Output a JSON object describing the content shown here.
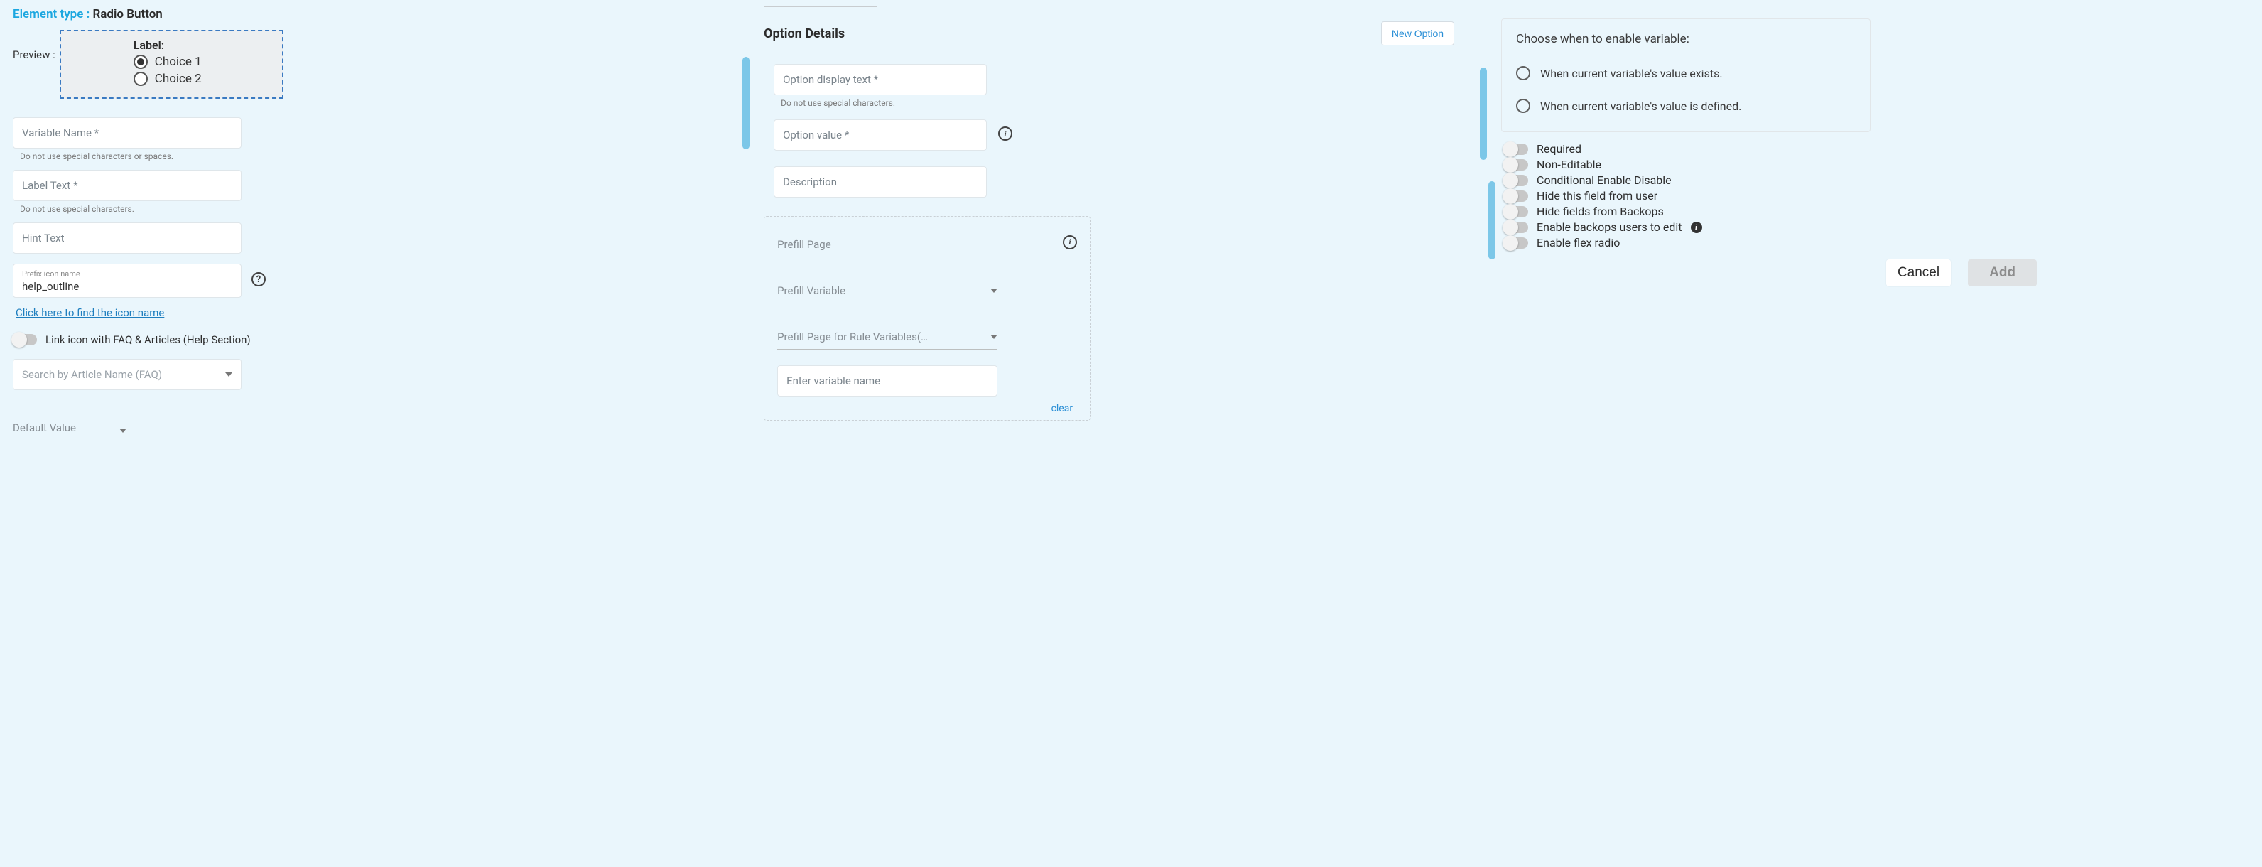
{
  "left": {
    "element_type_prefix": "Element type :",
    "element_type_value": "Radio Button",
    "preview_label": "Preview :",
    "preview_box_label": "Label:",
    "choices": [
      "Choice 1",
      "Choice 2"
    ],
    "variable_name_placeholder": "Variable Name *",
    "variable_name_helper": "Do not use special characters or spaces.",
    "label_text_placeholder": "Label Text *",
    "label_text_helper": "Do not use special characters.",
    "hint_text_placeholder": "Hint Text",
    "prefix_icon_float": "Prefix icon name",
    "prefix_icon_value": "help_outline",
    "find_icon_link": "Click here to find the icon name",
    "link_icon_toggle": "Link icon with FAQ & Articles (Help Section)",
    "faq_search_placeholder": "Search by Article Name (FAQ)",
    "default_value_label": "Default Value"
  },
  "middle": {
    "section_title": "Option Details",
    "new_option_btn": "New Option",
    "opt_display_placeholder": "Option display text *",
    "opt_display_helper": "Do not use special characters.",
    "opt_value_placeholder": "Option value *",
    "opt_desc_placeholder": "Description",
    "prefill_page_label": "Prefill Page",
    "prefill_variable_label": "Prefill Variable",
    "prefill_rule_label": "Prefill Page for Rule Variables(…",
    "enter_var_placeholder": "Enter variable name",
    "clear_label": "clear"
  },
  "right": {
    "panel_title": "Choose when to enable variable:",
    "radio_exists": "When current variable's value exists.",
    "radio_defined": "When current variable's value is defined.",
    "toggles": [
      "Required",
      "Non-Editable",
      "Conditional Enable Disable",
      "Hide this field from user",
      "Hide fields from Backops",
      "Enable backops users to edit",
      "Enable flex radio"
    ],
    "cancel": "Cancel",
    "add": "Add"
  }
}
